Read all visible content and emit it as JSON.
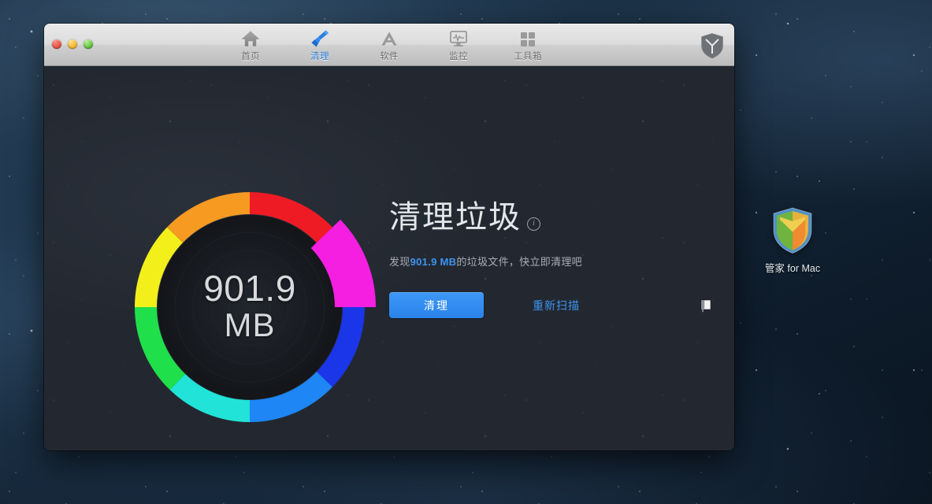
{
  "window": {
    "traffic_lights": [
      {
        "name": "close",
        "color": "#e0503f"
      },
      {
        "name": "minimize",
        "color": "#eeb329"
      },
      {
        "name": "zoom",
        "color": "#61c040"
      }
    ],
    "toolbar": {
      "items": [
        {
          "label": "首页",
          "icon": "home-icon",
          "active": false
        },
        {
          "label": "清理",
          "icon": "broom-icon",
          "active": true
        },
        {
          "label": "软件",
          "icon": "appstore-icon",
          "active": false
        },
        {
          "label": "监控",
          "icon": "monitor-icon",
          "active": false
        },
        {
          "label": "工具箱",
          "icon": "toolbox-grid-icon",
          "active": false
        }
      ],
      "corner_icon": "shield-icon",
      "active_color": "#2f7fd6",
      "inactive_color": "#6d6d6d"
    }
  },
  "gauge": {
    "amount": "901.9",
    "unit": "MB",
    "text_color": "#d7d9dc"
  },
  "panel": {
    "title": "清理垃圾",
    "info_icon": "info-icon",
    "info_glyph": "i",
    "subtitle_prefix": "发现",
    "subtitle_highlight": "901.9 MB",
    "subtitle_suffix": "的垃圾文件，快立即清理吧",
    "highlight_color": "#3c94f0",
    "clean_button": "清理",
    "rescan_link": "重新扫描",
    "note_icon": "note-page-icon"
  },
  "desktop": {
    "app_icon_label": "管家 for Mac",
    "app_icon_name": "guanjia-shield-icon"
  },
  "chart_data": {
    "type": "pie",
    "title": "清理垃圾",
    "center_label": "901.9 MB",
    "total": "901.9 MB",
    "legend_position": "none",
    "segments": [
      {
        "name": "red-segment",
        "color": "#ef1b24",
        "start_deg": 0,
        "end_deg": 46,
        "value": 46,
        "exploded": false
      },
      {
        "name": "magenta-segment",
        "color": "#f41fe1",
        "start_deg": 46,
        "end_deg": 90,
        "value": 44,
        "exploded": true
      },
      {
        "name": "darkblue-segment",
        "color": "#1b35e8",
        "start_deg": 90,
        "end_deg": 134,
        "value": 44,
        "exploded": false
      },
      {
        "name": "blue-segment",
        "color": "#1e86f5",
        "start_deg": 134,
        "end_deg": 180,
        "value": 46,
        "exploded": false
      },
      {
        "name": "cyan-segment",
        "color": "#21e3d8",
        "start_deg": 180,
        "end_deg": 224,
        "value": 44,
        "exploded": false
      },
      {
        "name": "green-segment",
        "color": "#1fe04a",
        "start_deg": 224,
        "end_deg": 270,
        "value": 46,
        "exploded": false
      },
      {
        "name": "yellow-segment",
        "color": "#f2ef1b",
        "start_deg": 270,
        "end_deg": 314,
        "value": 44,
        "exploded": false
      },
      {
        "name": "orange-segment",
        "color": "#f79a22",
        "start_deg": 314,
        "end_deg": 360,
        "value": 46,
        "exploded": false
      }
    ],
    "inner_radius": 118,
    "outer_radius": 146,
    "exploded_inner_radius": 108,
    "exploded_outer_radius": 160
  }
}
